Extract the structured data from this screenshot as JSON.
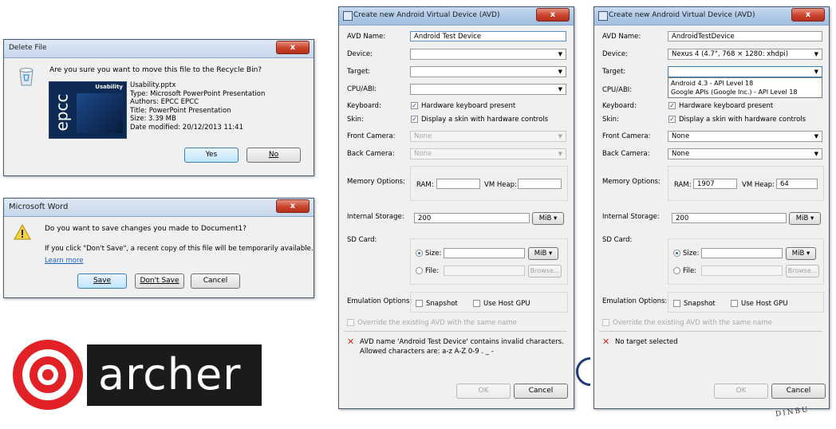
{
  "delete_dialog": {
    "title": "Delete File",
    "close": "x",
    "question": "Are you sure you want to move this file to the Recycle Bin?",
    "thumb_title": "Usability",
    "thumb_logo": "epcc",
    "details": [
      "Usability.pptx",
      "Type: Microsoft PowerPoint Presentation",
      "Authors: EPCC EPCC",
      "Title: PowerPoint Presentation",
      "Size: 3.39 MB",
      "Date modified: 20/12/2013 11:41"
    ],
    "yes": "Yes",
    "no": "No"
  },
  "word_dialog": {
    "title": "Microsoft Word",
    "close": "x",
    "question": "Do you want to save changes you made to Document1?",
    "info": "If you click \"Don't Save\", a recent copy of this file will be temporarily available.",
    "learn_more": "Learn more",
    "save": "Save",
    "dont_save": "Don't Save",
    "cancel": "Cancel"
  },
  "archer_logo": {
    "text": "archer"
  },
  "avd_left": {
    "title": "Create new Android Virtual Device (AVD)",
    "close": "x",
    "labels": {
      "avd_name": "AVD Name:",
      "device": "Device:",
      "target": "Target:",
      "cpu": "CPU/ABI:",
      "keyboard": "Keyboard:",
      "skin": "Skin:",
      "front_camera": "Front Camera:",
      "back_camera": "Back Camera:",
      "memory": "Memory Options:",
      "ram": "RAM:",
      "vm_heap": "VM Heap:",
      "internal_storage": "Internal Storage:",
      "sd_card": "SD Card:",
      "size": "Size:",
      "file": "File:",
      "emulation": "Emulation Options:"
    },
    "avd_name_value": "Android Test Device",
    "device_value": "",
    "target_value": "",
    "cpu_value": "",
    "keyboard_check": "Hardware keyboard present",
    "skin_check": "Display a skin with hardware controls",
    "front_camera_value": "None",
    "back_camera_value": "None",
    "ram_value": "",
    "vm_heap_value": "",
    "internal_storage_value": "200",
    "internal_storage_unit": "MiB",
    "sd_size_value": "",
    "sd_size_unit": "MiB",
    "sd_file_value": "",
    "browse": "Browse...",
    "snapshot": "Snapshot",
    "use_host_gpu": "Use Host GPU",
    "override": "Override the existing AVD with the same name",
    "error_line1": "AVD name 'Android Test Device' contains invalid characters.",
    "error_line2": "Allowed characters are: a-z A-Z 0-9 . _ -",
    "ok": "OK",
    "cancel": "Cancel"
  },
  "avd_right": {
    "title": "Create new Android Virtual Device (AVD)",
    "close": "x",
    "labels": {
      "avd_name": "AVD Name:",
      "device": "Device:",
      "target": "Target:",
      "cpu": "CPU/ABI:",
      "keyboard": "Keyboard:",
      "skin": "Skin:",
      "front_camera": "Front Camera:",
      "back_camera": "Back Camera:",
      "memory": "Memory Options:",
      "ram": "RAM:",
      "vm_heap": "VM Heap:",
      "internal_storage": "Internal Storage:",
      "sd_card": "SD Card:",
      "size": "Size:",
      "file": "File:",
      "emulation": "Emulation Options:"
    },
    "avd_name_value": "AndroidTestDevice",
    "device_value": "Nexus 4 (4.7\", 768 × 1280: xhdpi)",
    "target_value": "",
    "target_options": [
      "Android 4.3 - API Level 18",
      "Google APIs (Google Inc.) - API Level 18"
    ],
    "keyboard_check": "Hardware keyboard present",
    "skin_check": "Display a skin with hardware controls",
    "front_camera_value": "None",
    "back_camera_value": "None",
    "ram_value": "1907",
    "vm_heap_value": "64",
    "internal_storage_value": "200",
    "internal_storage_unit": "MiB",
    "sd_size_value": "",
    "sd_size_unit": "MiB",
    "sd_file_value": "",
    "browse": "Browse...",
    "snapshot": "Snapshot",
    "use_host_gpu": "Use Host GPU",
    "override": "Override the existing AVD with the same name",
    "error_line1": "No target selected",
    "ok": "OK",
    "cancel": "Cancel"
  },
  "background_fragment": {
    "text": "DINBU"
  }
}
